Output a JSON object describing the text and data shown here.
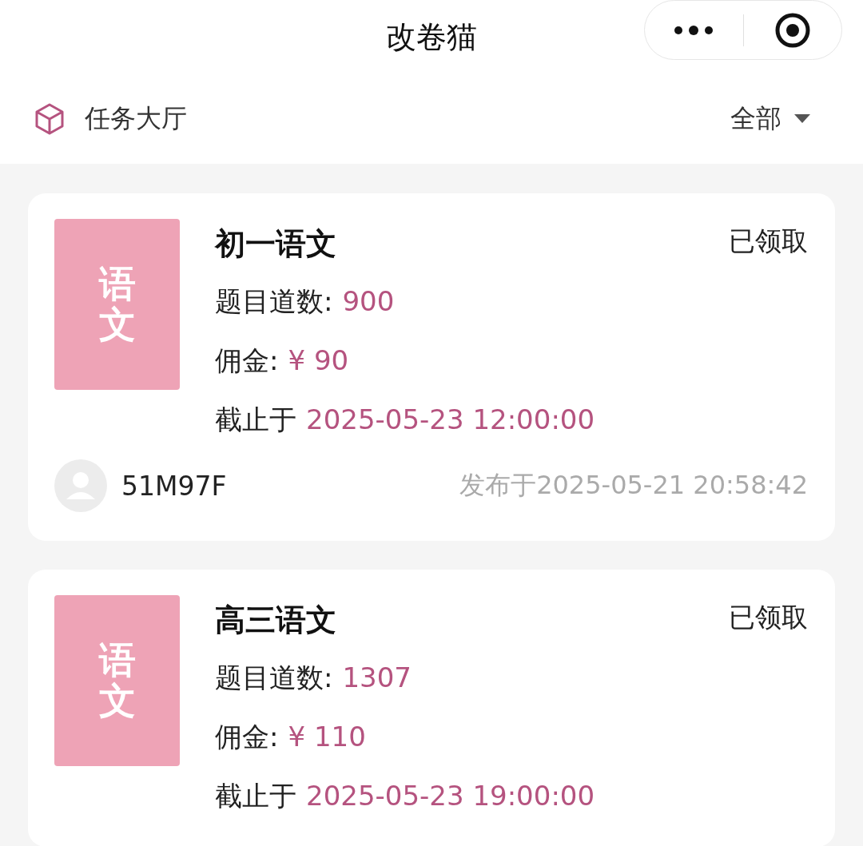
{
  "window": {
    "title": "改卷猫"
  },
  "header": {
    "title": "任务大厅",
    "filter": "全部"
  },
  "tasks": [
    {
      "thumb": "语文",
      "title": "初一语文",
      "status": "已领取",
      "count_label": "题目道数:",
      "count": "900",
      "fee_label": "佣金:",
      "fee": "¥ 90",
      "deadline_label": "截止于",
      "deadline": "2025-05-23 12:00:00",
      "publisher": "51M97F",
      "published": "发布于2025-05-21 20:58:42"
    },
    {
      "thumb": "语文",
      "title": "高三语文",
      "status": "已领取",
      "count_label": "题目道数:",
      "count": "1307",
      "fee_label": "佣金:",
      "fee": "¥ 110",
      "deadline_label": "截止于",
      "deadline": "2025-05-23 19:00:00"
    }
  ]
}
